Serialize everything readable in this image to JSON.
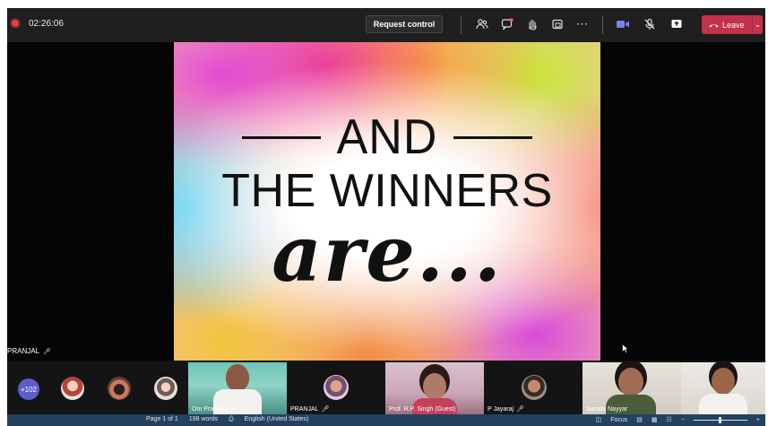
{
  "meeting": {
    "timer": "02:26:06",
    "request_control_label": "Request control",
    "leave_label": "Leave",
    "toolbar_icons": [
      "people-icon",
      "chat-icon",
      "raise-hand-icon",
      "share-tray-icon",
      "more-icon",
      "camera-icon",
      "mic-off-icon",
      "share-screen-icon"
    ]
  },
  "slide": {
    "line1": "AND",
    "line2": "THE WINNERS",
    "line3": "are..."
  },
  "stage": {
    "presenter_label": "PRANJAL"
  },
  "participants": {
    "overflow_count": "+102",
    "tiles": [
      {
        "name": "Om Prakash"
      },
      {
        "name": "PRANJAL"
      },
      {
        "name": "Prof. R.P. Singh (Guest)"
      },
      {
        "name": "P Jayaraj"
      },
      {
        "name": "Namita Nayyar"
      },
      {
        "name": ""
      }
    ]
  },
  "statusbar": {
    "page": "Page 1 of 1",
    "words": "198 words",
    "language": "English (United States)",
    "focus": "Focus"
  },
  "colors": {
    "topbar": "#1f1f1f",
    "leave": "#c4314b",
    "badge": "#5b5fc7",
    "statusbar": "#24415f"
  }
}
